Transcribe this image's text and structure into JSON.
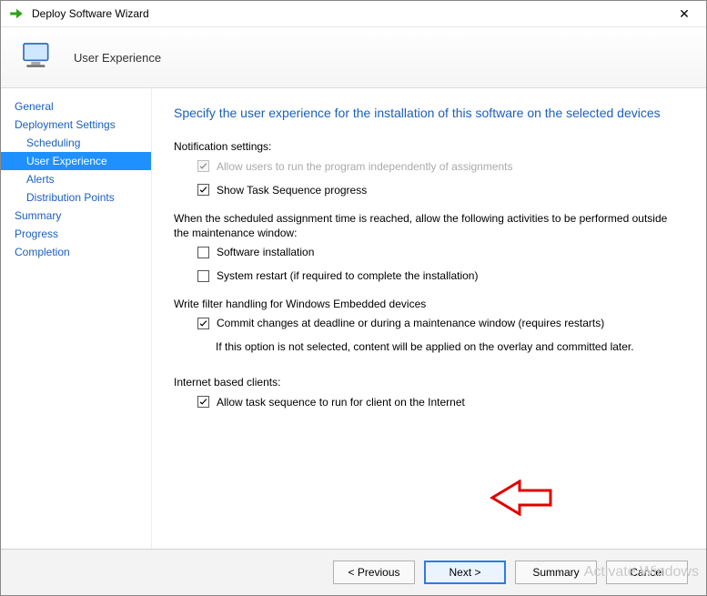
{
  "window": {
    "title": "Deploy Software Wizard"
  },
  "header": {
    "label": "User Experience"
  },
  "nav": [
    {
      "label": "General",
      "sub": false
    },
    {
      "label": "Deployment Settings",
      "sub": false
    },
    {
      "label": "Scheduling",
      "sub": true
    },
    {
      "label": "User Experience",
      "sub": true
    },
    {
      "label": "Alerts",
      "sub": true
    },
    {
      "label": "Distribution Points",
      "sub": true
    },
    {
      "label": "Summary",
      "sub": false
    },
    {
      "label": "Progress",
      "sub": false
    },
    {
      "label": "Completion",
      "sub": false
    }
  ],
  "nav_selected_index": 3,
  "content": {
    "heading": "Specify the user experience for the installation of this software on the selected devices",
    "notification_label": "Notification settings:",
    "allow_independent": {
      "label": "Allow users to run the program independently of assignments",
      "checked": true,
      "enabled": false
    },
    "show_ts_progress": {
      "label": "Show Task Sequence progress",
      "checked": true,
      "enabled": true
    },
    "scheduled_text": "When the scheduled assignment time is reached, allow the following activities to be performed outside the maintenance window:",
    "software_install": {
      "label": "Software installation",
      "checked": false,
      "enabled": true
    },
    "system_restart": {
      "label": "System restart (if required to complete the installation)",
      "checked": false,
      "enabled": true
    },
    "write_filter_label": "Write filter handling for Windows Embedded devices",
    "commit_changes": {
      "label": "Commit changes at deadline or during a maintenance window (requires restarts)",
      "checked": true,
      "enabled": true
    },
    "commit_note": "If this option is not selected, content will be applied on the overlay and committed later.",
    "internet_label": "Internet based clients:",
    "internet_allow": {
      "label": "Allow task sequence to run for client on the Internet",
      "checked": true,
      "enabled": true
    }
  },
  "buttons": {
    "previous": "< Previous",
    "next": "Next >",
    "summary": "Summary",
    "cancel": "Cancel"
  },
  "watermark": "Activate Windows"
}
